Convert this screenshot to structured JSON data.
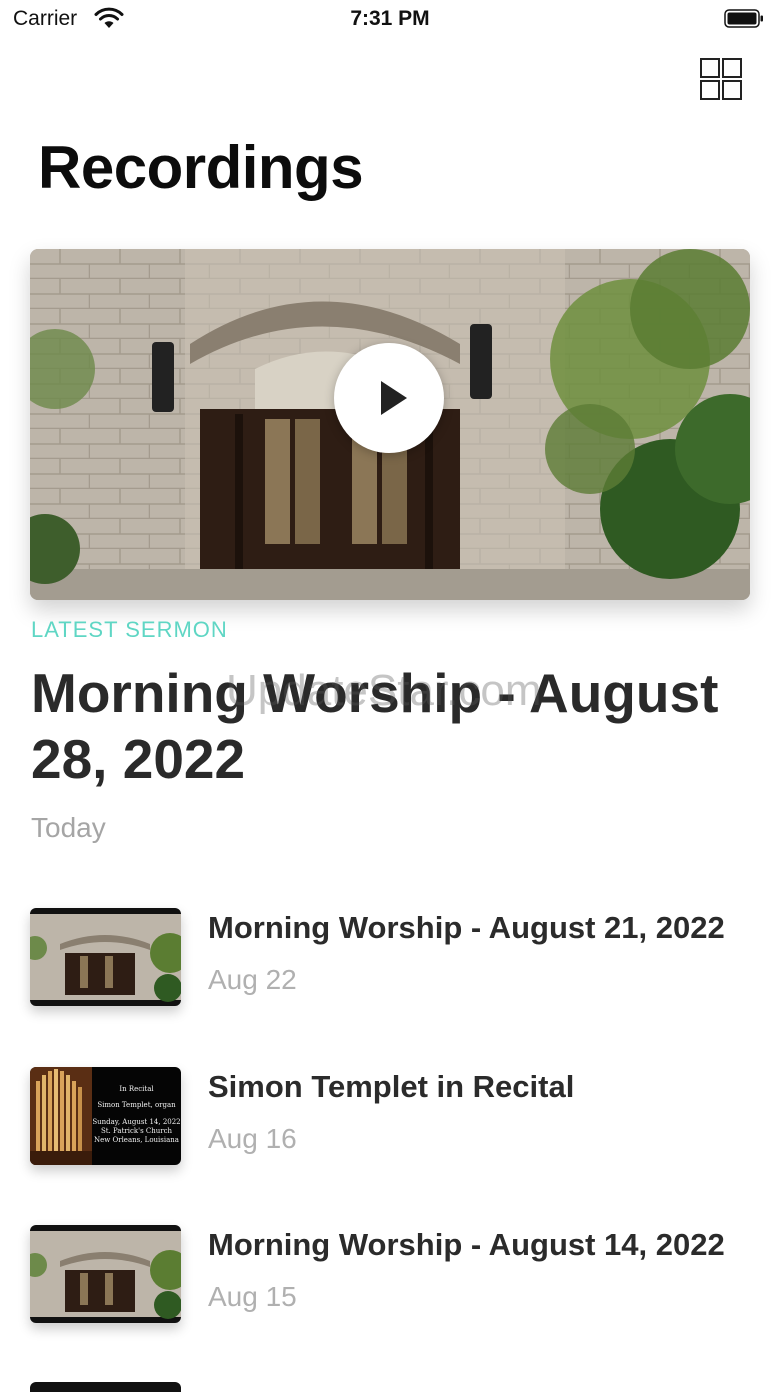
{
  "status_bar": {
    "carrier": "Carrier",
    "time": "7:31 PM"
  },
  "header": {
    "title": "Recordings",
    "grid_icon": "grid-icon"
  },
  "hero": {
    "label": "LATEST SERMON",
    "title": "Morning Worship - August 28, 2022",
    "date": "Today",
    "watermark": "UpdateStar.com",
    "play_icon": "play-icon"
  },
  "recordings": [
    {
      "title": "Morning Worship - August 21, 2022",
      "date": "Aug 22",
      "thumbnail": "church-entrance"
    },
    {
      "title": "Simon Templet in Recital",
      "date": "Aug 16",
      "thumbnail": "organ-recital",
      "thumb_text": {
        "heading": "In Recital",
        "performer": "Simon Templet, organ",
        "date": "Sunday, August 14, 2022",
        "venue": "St. Patrick's Church",
        "city": "New Orleans, Louisiana"
      }
    },
    {
      "title": "Morning Worship - August 14, 2022",
      "date": "Aug 15",
      "thumbnail": "church-entrance"
    }
  ],
  "colors": {
    "accent": "#5fd6c4",
    "text": "#2b2b2b",
    "secondary": "#a5a5a5"
  }
}
